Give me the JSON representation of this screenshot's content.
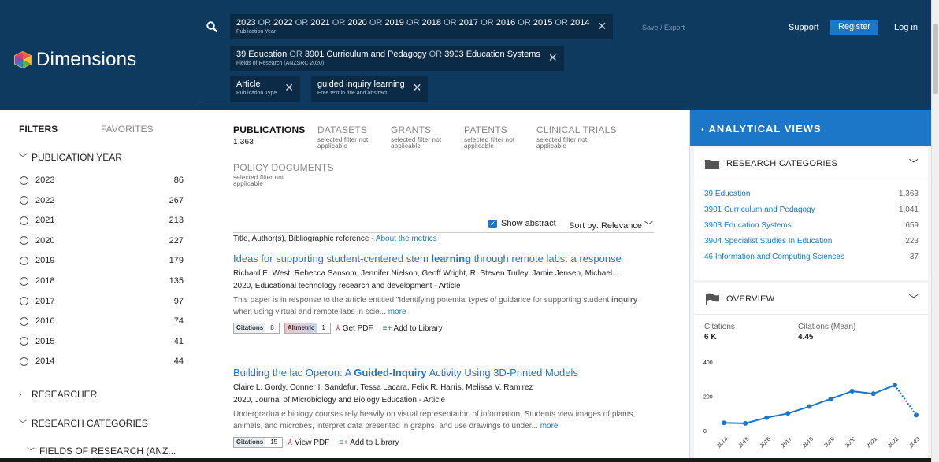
{
  "header": {
    "logo_text": "Dimensions",
    "chips": [
      {
        "parts": [
          {
            "t": "2023",
            "kw": false
          },
          {
            "t": " OR ",
            "kw": true
          },
          {
            "t": "2022",
            "kw": false
          },
          {
            "t": " OR ",
            "kw": true
          },
          {
            "t": "2021",
            "kw": false
          },
          {
            "t": " OR ",
            "kw": true
          },
          {
            "t": "2020",
            "kw": false
          },
          {
            "t": " OR ",
            "kw": true
          },
          {
            "t": "2019",
            "kw": false
          },
          {
            "t": " OR ",
            "kw": true
          },
          {
            "t": "2018",
            "kw": false
          },
          {
            "t": " OR ",
            "kw": true
          },
          {
            "t": "2017",
            "kw": false
          },
          {
            "t": " OR ",
            "kw": true
          },
          {
            "t": "2016",
            "kw": false
          },
          {
            "t": " OR ",
            "kw": true
          },
          {
            "t": "2015",
            "kw": false
          },
          {
            "t": " OR ",
            "kw": true
          },
          {
            "t": "2014",
            "kw": false
          }
        ],
        "sub": "Publication Year"
      },
      {
        "parts": [
          {
            "t": "39 Education",
            "kw": false
          },
          {
            "t": " OR ",
            "kw": true
          },
          {
            "t": "3901 Curriculum and Pedagogy",
            "kw": false
          },
          {
            "t": " OR ",
            "kw": true
          },
          {
            "t": "3903 Education Systems",
            "kw": false
          }
        ],
        "sub": "Fields of Research (ANZSRC 2020)"
      },
      {
        "parts": [
          {
            "t": "Article",
            "kw": false
          }
        ],
        "sub": "Publication Type"
      },
      {
        "parts": [
          {
            "t": "guided inquiry learning",
            "kw": false
          }
        ],
        "sub": "Free text in title and abstract"
      }
    ],
    "save_export": "Save / Export",
    "support": "Support",
    "register": "Register",
    "login": "Log in"
  },
  "sidebar": {
    "tab_filters": "FILTERS",
    "tab_favorites": "FAVORITES",
    "publication_year_label": "PUBLICATION YEAR",
    "years": [
      {
        "year": "2023",
        "count": "86"
      },
      {
        "year": "2022",
        "count": "267"
      },
      {
        "year": "2021",
        "count": "213"
      },
      {
        "year": "2020",
        "count": "227"
      },
      {
        "year": "2019",
        "count": "179"
      },
      {
        "year": "2018",
        "count": "135"
      },
      {
        "year": "2017",
        "count": "97"
      },
      {
        "year": "2016",
        "count": "74"
      },
      {
        "year": "2015",
        "count": "41"
      },
      {
        "year": "2014",
        "count": "44"
      }
    ],
    "researcher_label": "RESEARCHER",
    "research_categories_label": "RESEARCH CATEGORIES",
    "fields_label": "FIELDS OF RESEARCH (ANZ..."
  },
  "content": {
    "tabs": {
      "publications": {
        "label": "PUBLICATIONS",
        "count": "1,363"
      },
      "datasets": {
        "label": "DATASETS",
        "note": "selected filter not applicable"
      },
      "grants": {
        "label": "GRANTS",
        "note": "selected filter not applicable"
      },
      "patents": {
        "label": "PATENTS",
        "note": "selected filter not applicable"
      },
      "clinical_trials": {
        "label": "CLINICAL TRIALS",
        "note": "selected filter not applicable"
      },
      "policy_documents": {
        "label": "POLICY DOCUMENTS",
        "note": "selected filter not applicable"
      }
    },
    "show_abstract": "Show abstract",
    "sort_by": "Sort by: Relevance",
    "meta_prefix": "Title, Author(s), Bibliographic reference - ",
    "meta_link": "About the metrics",
    "results": [
      {
        "title_parts": [
          {
            "t": "Ideas for supporting student-centered stem ",
            "b": false
          },
          {
            "t": "learning",
            "b": true
          },
          {
            "t": " through remote labs: a response",
            "b": false
          }
        ],
        "authors": "Richard E. West, Rebecca Sansom, Jennifer Nielson, Geoff Wright, R. Steven Turley, Jamie Jensen, Michael...",
        "publication": "2020, Educational technology research and development - Article",
        "abstract_parts": [
          {
            "t": "This paper is in response to the article entitled \"Identifying potential types of guidance for supporting student ",
            "b": false
          },
          {
            "t": "inquiry",
            "b": true
          },
          {
            "t": " when using virtual and remote labs in scie... ",
            "b": false
          }
        ],
        "more": "more",
        "citations_label": "Citations",
        "citations": "8",
        "altmetric_label": "Altmetric",
        "altmetric": "1",
        "pdf_label": "Get PDF",
        "library_label": "Add to Library"
      },
      {
        "title_parts": [
          {
            "t": "Building the lac Operon: A ",
            "b": false
          },
          {
            "t": "Guided-Inquiry",
            "b": true
          },
          {
            "t": " Activity Using 3D-Printed Models",
            "b": false
          }
        ],
        "authors": "Claire L. Gordy, Conner I. Sandefur, Tessa Lacara, Felix R. Harris, Melissa V. Ramirez",
        "publication": "2020, Journal of Microbiology and Biology Education - Article",
        "abstract_parts": [
          {
            "t": "Undergraduate biology courses rely heavily on visual representation of information. Students view images of plants, animals, and microbes, interpret data presented in graphs, and use drawings to under... ",
            "b": false
          }
        ],
        "more": "more",
        "citations_label": "Citations",
        "citations": "15",
        "pdf_label": "View PDF",
        "library_label": "Add to Library"
      }
    ]
  },
  "rpanel": {
    "title": "ANALYTICAL VIEWS",
    "research_categories_title": "RESEARCH CATEGORIES",
    "categories": [
      {
        "name": "39 Education",
        "count": "1,363"
      },
      {
        "name": "3901 Curriculum and Pedagogy",
        "count": "1,041"
      },
      {
        "name": "3903 Education Systems",
        "count": "659"
      },
      {
        "name": "3904 Specialist Studies In Education",
        "count": "223"
      },
      {
        "name": "46 Information and Computing Sciences",
        "count": "37"
      }
    ],
    "overview_title": "OVERVIEW",
    "citations_label": "Citations",
    "citations_value": "6 K",
    "citations_mean_label": "Citations (Mean)",
    "citations_mean_value": "4.45"
  },
  "chart_data": {
    "type": "line",
    "x": [
      "2014",
      "2015",
      "2016",
      "2017",
      "2018",
      "2019",
      "2020",
      "2021",
      "2022",
      "2023"
    ],
    "series": [
      {
        "values": [
          45,
          42,
          75,
          100,
          140,
          185,
          230,
          215,
          265,
          90
        ]
      }
    ],
    "yticks": [
      0,
      200,
      400
    ],
    "ylim": [
      0,
      400
    ],
    "color": "#1a78cc",
    "last_segment_dotted": true
  },
  "colors": {
    "header_bg": "#0f3a5f",
    "chip_bg": "#0b2a45",
    "accent": "#1a78cc",
    "panel_bg": "#f2f4f6"
  }
}
